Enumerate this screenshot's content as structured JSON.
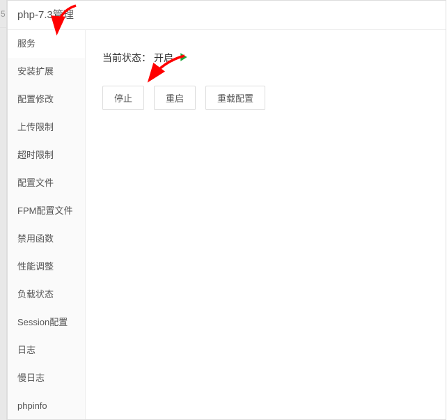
{
  "edge": {
    "topLabel": "5"
  },
  "header": {
    "title": "php-7.3管理"
  },
  "sidebar": {
    "items": [
      {
        "label": "服务",
        "key": "service",
        "active": true
      },
      {
        "label": "安装扩展",
        "key": "install-ext",
        "active": false
      },
      {
        "label": "配置修改",
        "key": "config-edit",
        "active": false
      },
      {
        "label": "上传限制",
        "key": "upload-limit",
        "active": false
      },
      {
        "label": "超时限制",
        "key": "timeout-limit",
        "active": false
      },
      {
        "label": "配置文件",
        "key": "config-file",
        "active": false
      },
      {
        "label": "FPM配置文件",
        "key": "fpm-config",
        "active": false
      },
      {
        "label": "禁用函数",
        "key": "disable-func",
        "active": false
      },
      {
        "label": "性能调整",
        "key": "performance",
        "active": false
      },
      {
        "label": "负载状态",
        "key": "load-status",
        "active": false
      },
      {
        "label": "Session配置",
        "key": "session-config",
        "active": false
      },
      {
        "label": "日志",
        "key": "log",
        "active": false
      },
      {
        "label": "慢日志",
        "key": "slow-log",
        "active": false
      },
      {
        "label": "phpinfo",
        "key": "phpinfo",
        "active": false
      }
    ]
  },
  "content": {
    "status": {
      "label": "当前状态：",
      "value": "开启"
    },
    "buttons": {
      "stop": "停止",
      "restart": "重启",
      "reload": "重载配置"
    }
  },
  "arrowColor": "#ff0000"
}
